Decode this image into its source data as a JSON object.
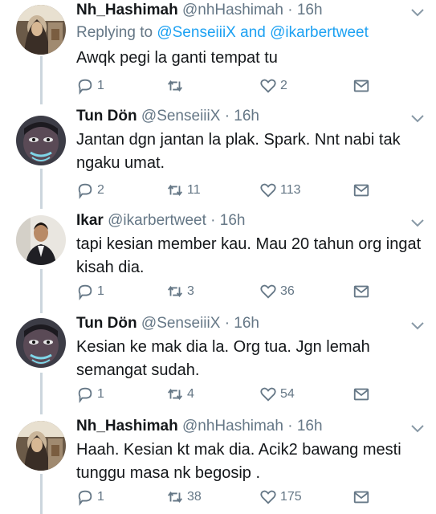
{
  "tweets": [
    {
      "name": "Nh_Hashimah",
      "handle": "@nhHashimah",
      "separator": "·",
      "time": "16h",
      "reply_prefix": "Replying to",
      "reply_user1": "@SenseiiiX",
      "reply_and": "and",
      "reply_user2": "@ikarbertweet",
      "text": "Awqk pegi la ganti tempat tu",
      "replies": "1",
      "retweets": "",
      "likes": "2",
      "avatar": "woman-hijab-avatar"
    },
    {
      "name": "Tun Dön",
      "handle": "@SenseiiiX",
      "separator": "·",
      "time": "16h",
      "text": "Jantan dgn jantan la plak. Spark. Nnt nabi tak ngaku umat.",
      "replies": "2",
      "retweets": "11",
      "likes": "113",
      "avatar": "painted-face-avatar"
    },
    {
      "name": "Ikar",
      "handle": "@ikarbertweet",
      "separator": "·",
      "time": "16h",
      "text": "tapi kesian member kau. Mau 20 tahun org ingat kisah dia.",
      "replies": "1",
      "retweets": "3",
      "likes": "36",
      "avatar": "man-suit-avatar"
    },
    {
      "name": "Tun Dön",
      "handle": "@SenseiiiX",
      "separator": "·",
      "time": "16h",
      "text": "Kesian ke mak dia la. Org tua. Jgn lemah semangat sudah.",
      "replies": "1",
      "retweets": "4",
      "likes": "54",
      "avatar": "painted-face-avatar"
    },
    {
      "name": "Nh_Hashimah",
      "handle": "@nhHashimah",
      "separator": "·",
      "time": "16h",
      "text": "Haah. Kesian kt mak dia. Acik2 bawang mesti tunggu masa nk begosip .",
      "replies": "1",
      "retweets": "38",
      "likes": "175",
      "avatar": "woman-hijab-avatar"
    }
  ],
  "colors": {
    "link": "#1da1f2",
    "secondary": "#657786",
    "thread_line": "#ccd6dd"
  }
}
